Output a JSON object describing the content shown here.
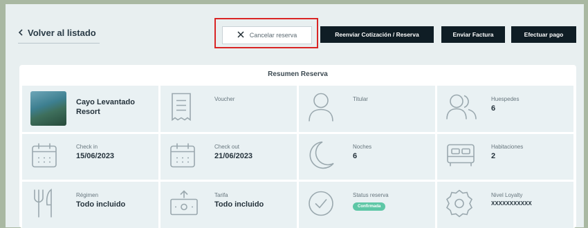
{
  "nav": {
    "back_label": "Volver al listado"
  },
  "actions": {
    "cancel_label": "Cancelar reserva",
    "resend_label": "Reenviar Cotización / Reserva",
    "invoice_label": "Enviar Factura",
    "pay_label": "Efectuar pago"
  },
  "summary": {
    "title": "Resumen Reserva",
    "hotel": {
      "name_line1": "Cayo Levantado",
      "name_line2": "Resort"
    },
    "voucher": {
      "label": "Voucher"
    },
    "titular": {
      "label": "Titular"
    },
    "guests": {
      "label": "Huespedes",
      "value": "6"
    },
    "checkin": {
      "label": "Check in",
      "value": "15/06/2023"
    },
    "checkout": {
      "label": "Check out",
      "value": "21/06/2023"
    },
    "nights": {
      "label": "Noches",
      "value": "6"
    },
    "rooms": {
      "label": "Habitaciones",
      "value": "2"
    },
    "regime": {
      "label": "Régimen",
      "value": "Todo incluido"
    },
    "tariff": {
      "label": "Tarifa",
      "value": "Todo incluido"
    },
    "status": {
      "label": "Status reserva",
      "badge": "Confirmada"
    },
    "loyalty": {
      "label": "Nivel Loyalty",
      "value": "XXXXXXXXXXX"
    }
  },
  "colors": {
    "accent_dark": "#0f1d25",
    "highlight": "#d92424",
    "badge": "#5ec7a6",
    "cell_bg": "#e9f1f3"
  }
}
